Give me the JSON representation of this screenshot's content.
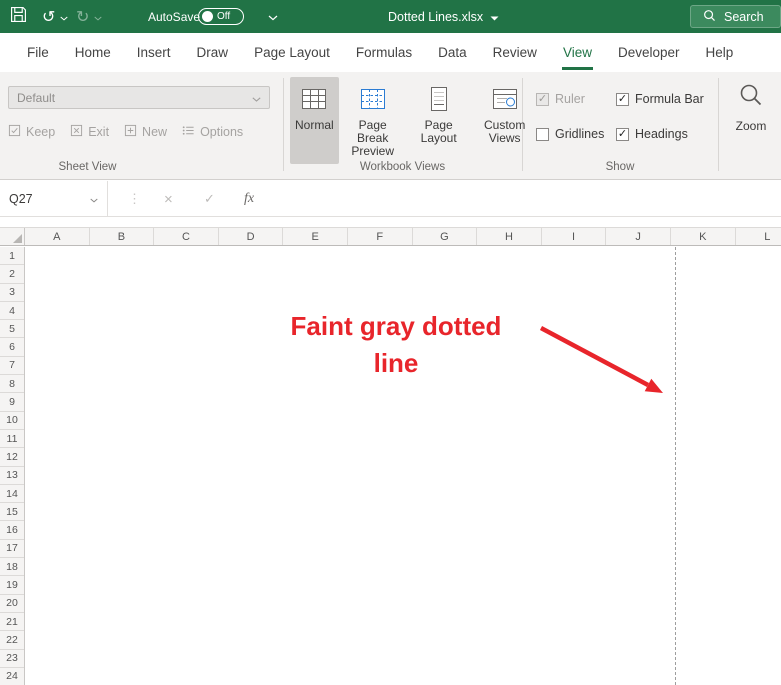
{
  "titlebar": {
    "autosave_label": "AutoSave",
    "autosave_state": "Off",
    "document_title": "Dotted Lines.xlsx",
    "search_label": "Search"
  },
  "ribbon_tabs": [
    {
      "label": "File",
      "active": false
    },
    {
      "label": "Home",
      "active": false
    },
    {
      "label": "Insert",
      "active": false
    },
    {
      "label": "Draw",
      "active": false
    },
    {
      "label": "Page Layout",
      "active": false
    },
    {
      "label": "Formulas",
      "active": false
    },
    {
      "label": "Data",
      "active": false
    },
    {
      "label": "Review",
      "active": false
    },
    {
      "label": "View",
      "active": true
    },
    {
      "label": "Developer",
      "active": false
    },
    {
      "label": "Help",
      "active": false
    }
  ],
  "ribbon": {
    "sheet_view": {
      "label": "Sheet View",
      "dropdown_value": "Default",
      "buttons": [
        {
          "label": "Keep",
          "icon": "keep-icon",
          "disabled": true
        },
        {
          "label": "Exit",
          "icon": "exit-icon",
          "disabled": true
        },
        {
          "label": "New",
          "icon": "new-icon",
          "disabled": true
        },
        {
          "label": "Options",
          "icon": "options-icon",
          "disabled": true
        }
      ]
    },
    "workbook_views": {
      "label": "Workbook Views",
      "buttons": [
        {
          "label": "Normal",
          "icon": "normal-view-icon",
          "selected": true
        },
        {
          "label": "Page Break Preview",
          "icon": "page-break-preview-icon",
          "selected": false
        },
        {
          "label": "Page Layout",
          "icon": "page-layout-icon",
          "selected": false
        },
        {
          "label": "Custom Views",
          "icon": "custom-views-icon",
          "selected": false
        }
      ]
    },
    "show": {
      "label": "Show",
      "checkboxes": [
        {
          "label": "Ruler",
          "checked": true,
          "disabled": true
        },
        {
          "label": "Formula Bar",
          "checked": true,
          "disabled": false
        },
        {
          "label": "Gridlines",
          "checked": false,
          "disabled": false
        },
        {
          "label": "Headings",
          "checked": true,
          "disabled": false
        }
      ]
    },
    "zoom": {
      "label": "Zoom"
    }
  },
  "formula_bar": {
    "name_box": "Q27",
    "fx_label": "fx"
  },
  "grid": {
    "columns": [
      "A",
      "B",
      "C",
      "D",
      "E",
      "F",
      "G",
      "H",
      "I",
      "J",
      "K",
      "L"
    ],
    "rows": [
      "1",
      "2",
      "3",
      "4",
      "5",
      "6",
      "7",
      "8",
      "9",
      "10",
      "11",
      "12",
      "13",
      "14",
      "15",
      "16",
      "17",
      "18",
      "19",
      "20",
      "21",
      "22",
      "23",
      "24"
    ]
  },
  "annotation": {
    "line1": "Faint gray dotted",
    "line2": "line",
    "color": "#E8252B"
  },
  "colors": {
    "excel_green": "#217346",
    "page_break_line": "#9E9E9E"
  }
}
